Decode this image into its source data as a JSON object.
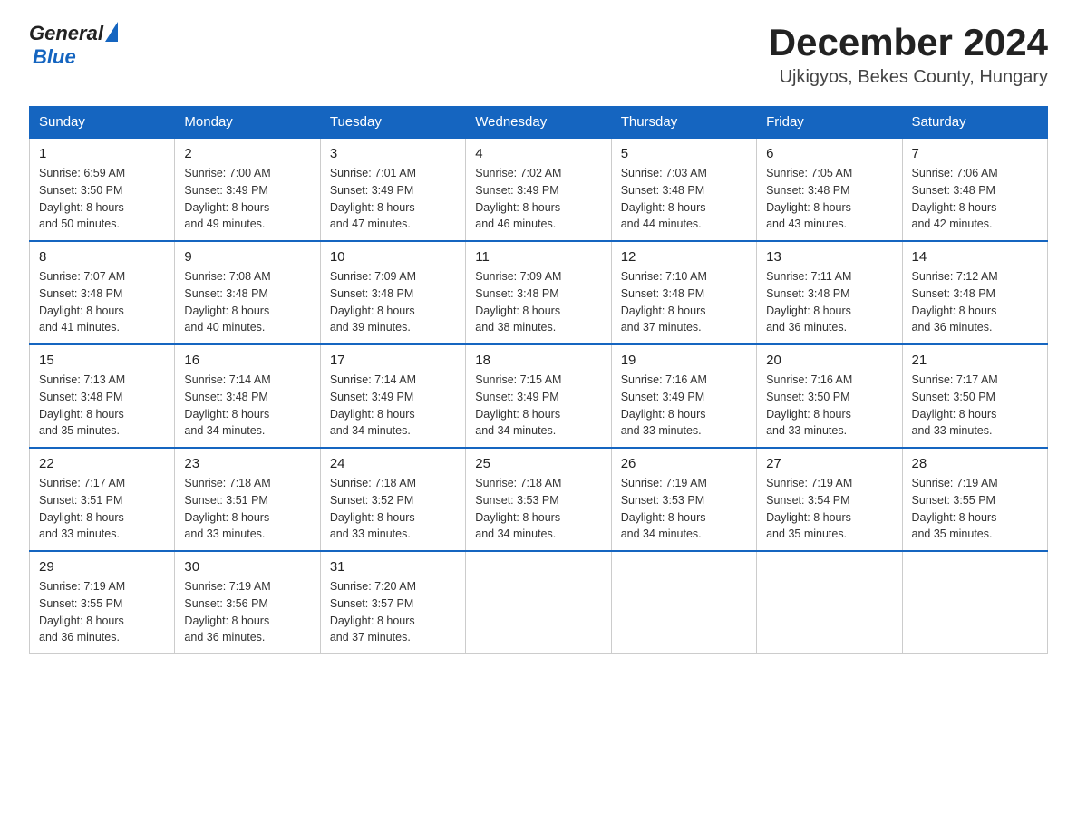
{
  "header": {
    "logo_general": "General",
    "logo_blue": "Blue",
    "month_title": "December 2024",
    "location": "Ujkigyos, Bekes County, Hungary"
  },
  "days_of_week": [
    "Sunday",
    "Monday",
    "Tuesday",
    "Wednesday",
    "Thursday",
    "Friday",
    "Saturday"
  ],
  "weeks": [
    [
      {
        "day": "1",
        "sunrise": "6:59 AM",
        "sunset": "3:50 PM",
        "daylight": "8 hours and 50 minutes."
      },
      {
        "day": "2",
        "sunrise": "7:00 AM",
        "sunset": "3:49 PM",
        "daylight": "8 hours and 49 minutes."
      },
      {
        "day": "3",
        "sunrise": "7:01 AM",
        "sunset": "3:49 PM",
        "daylight": "8 hours and 47 minutes."
      },
      {
        "day": "4",
        "sunrise": "7:02 AM",
        "sunset": "3:49 PM",
        "daylight": "8 hours and 46 minutes."
      },
      {
        "day": "5",
        "sunrise": "7:03 AM",
        "sunset": "3:48 PM",
        "daylight": "8 hours and 44 minutes."
      },
      {
        "day": "6",
        "sunrise": "7:05 AM",
        "sunset": "3:48 PM",
        "daylight": "8 hours and 43 minutes."
      },
      {
        "day": "7",
        "sunrise": "7:06 AM",
        "sunset": "3:48 PM",
        "daylight": "8 hours and 42 minutes."
      }
    ],
    [
      {
        "day": "8",
        "sunrise": "7:07 AM",
        "sunset": "3:48 PM",
        "daylight": "8 hours and 41 minutes."
      },
      {
        "day": "9",
        "sunrise": "7:08 AM",
        "sunset": "3:48 PM",
        "daylight": "8 hours and 40 minutes."
      },
      {
        "day": "10",
        "sunrise": "7:09 AM",
        "sunset": "3:48 PM",
        "daylight": "8 hours and 39 minutes."
      },
      {
        "day": "11",
        "sunrise": "7:09 AM",
        "sunset": "3:48 PM",
        "daylight": "8 hours and 38 minutes."
      },
      {
        "day": "12",
        "sunrise": "7:10 AM",
        "sunset": "3:48 PM",
        "daylight": "8 hours and 37 minutes."
      },
      {
        "day": "13",
        "sunrise": "7:11 AM",
        "sunset": "3:48 PM",
        "daylight": "8 hours and 36 minutes."
      },
      {
        "day": "14",
        "sunrise": "7:12 AM",
        "sunset": "3:48 PM",
        "daylight": "8 hours and 36 minutes."
      }
    ],
    [
      {
        "day": "15",
        "sunrise": "7:13 AM",
        "sunset": "3:48 PM",
        "daylight": "8 hours and 35 minutes."
      },
      {
        "day": "16",
        "sunrise": "7:14 AM",
        "sunset": "3:48 PM",
        "daylight": "8 hours and 34 minutes."
      },
      {
        "day": "17",
        "sunrise": "7:14 AM",
        "sunset": "3:49 PM",
        "daylight": "8 hours and 34 minutes."
      },
      {
        "day": "18",
        "sunrise": "7:15 AM",
        "sunset": "3:49 PM",
        "daylight": "8 hours and 34 minutes."
      },
      {
        "day": "19",
        "sunrise": "7:16 AM",
        "sunset": "3:49 PM",
        "daylight": "8 hours and 33 minutes."
      },
      {
        "day": "20",
        "sunrise": "7:16 AM",
        "sunset": "3:50 PM",
        "daylight": "8 hours and 33 minutes."
      },
      {
        "day": "21",
        "sunrise": "7:17 AM",
        "sunset": "3:50 PM",
        "daylight": "8 hours and 33 minutes."
      }
    ],
    [
      {
        "day": "22",
        "sunrise": "7:17 AM",
        "sunset": "3:51 PM",
        "daylight": "8 hours and 33 minutes."
      },
      {
        "day": "23",
        "sunrise": "7:18 AM",
        "sunset": "3:51 PM",
        "daylight": "8 hours and 33 minutes."
      },
      {
        "day": "24",
        "sunrise": "7:18 AM",
        "sunset": "3:52 PM",
        "daylight": "8 hours and 33 minutes."
      },
      {
        "day": "25",
        "sunrise": "7:18 AM",
        "sunset": "3:53 PM",
        "daylight": "8 hours and 34 minutes."
      },
      {
        "day": "26",
        "sunrise": "7:19 AM",
        "sunset": "3:53 PM",
        "daylight": "8 hours and 34 minutes."
      },
      {
        "day": "27",
        "sunrise": "7:19 AM",
        "sunset": "3:54 PM",
        "daylight": "8 hours and 35 minutes."
      },
      {
        "day": "28",
        "sunrise": "7:19 AM",
        "sunset": "3:55 PM",
        "daylight": "8 hours and 35 minutes."
      }
    ],
    [
      {
        "day": "29",
        "sunrise": "7:19 AM",
        "sunset": "3:55 PM",
        "daylight": "8 hours and 36 minutes."
      },
      {
        "day": "30",
        "sunrise": "7:19 AM",
        "sunset": "3:56 PM",
        "daylight": "8 hours and 36 minutes."
      },
      {
        "day": "31",
        "sunrise": "7:20 AM",
        "sunset": "3:57 PM",
        "daylight": "8 hours and 37 minutes."
      },
      null,
      null,
      null,
      null
    ]
  ],
  "labels": {
    "sunrise": "Sunrise:",
    "sunset": "Sunset:",
    "daylight": "Daylight:"
  }
}
